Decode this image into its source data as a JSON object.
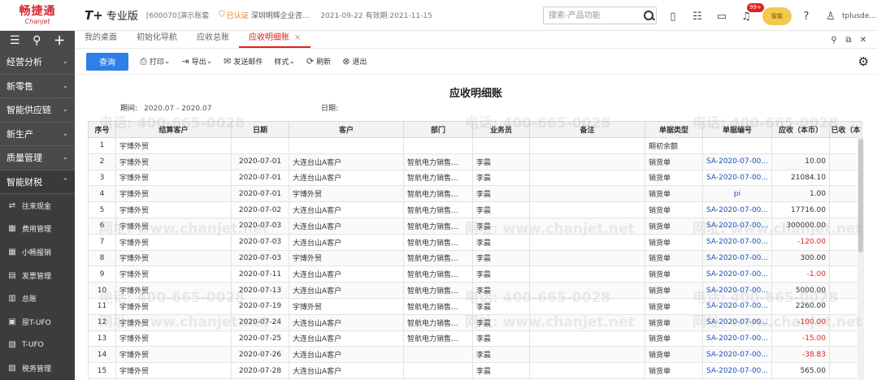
{
  "brand": {
    "name_cn": "畅捷通",
    "name_en": "Chanjet"
  },
  "product": {
    "mark": "T+",
    "edition": "专业版"
  },
  "account": "[600070]演示账套",
  "cert": {
    "label": "已认证",
    "company": "深圳明辉企业咨..."
  },
  "date_info": "2021-09-22  有效期:2021-11-15",
  "search": {
    "placeholder": "搜索-产品功能"
  },
  "header_icons": [
    "phone-icon",
    "checklist-icon",
    "monitor-icon",
    "bell-icon",
    "help-icon",
    "user-icon"
  ],
  "notification_badge": "99+",
  "mascot_text": "智能",
  "user": "tplusde...",
  "sidebar": {
    "groups": [
      {
        "label": "经营分析"
      },
      {
        "label": "新零售"
      },
      {
        "label": "智能供应链"
      },
      {
        "label": "新生产"
      },
      {
        "label": "质量管理"
      },
      {
        "label": "智能财税"
      }
    ],
    "sub_items": [
      {
        "label": "往来现金",
        "icon": "cash-icon"
      },
      {
        "label": "费用管理",
        "icon": "expense-icon"
      },
      {
        "label": "小畅报销",
        "icon": "reimburse-icon"
      },
      {
        "label": "发票管理",
        "icon": "invoice-icon"
      },
      {
        "label": "总账",
        "icon": "ledger-icon"
      },
      {
        "label": "原T-UFO",
        "icon": "ufo-icon"
      },
      {
        "label": "T-UFO",
        "icon": "tufo-icon"
      },
      {
        "label": "税务管理",
        "icon": "tax-icon"
      }
    ]
  },
  "tabs": [
    {
      "label": "我的桌面"
    },
    {
      "label": "初始化导航"
    },
    {
      "label": "应收总账"
    },
    {
      "label": "应收明细账",
      "active": true,
      "close": "×"
    }
  ],
  "toolbar": {
    "query": "查询",
    "print": "打印",
    "export": "导出",
    "send_mail": "发送邮件",
    "style": "样式",
    "refresh": "刷新",
    "exit": "退出"
  },
  "report": {
    "title": "应收明细账",
    "period_label": "期间:",
    "period_value": "2020.07 - 2020.07",
    "date_label": "日期:"
  },
  "table": {
    "columns": [
      "序号",
      "结算客户",
      "日期",
      "客户",
      "部门",
      "业务员",
      "备注",
      "单据类型",
      "单据编号",
      "应收（本币）",
      "已收（本"
    ],
    "rows": [
      [
        "1",
        "宇博外贸",
        "",
        "",
        "",
        "",
        "",
        "期初余额",
        "",
        "",
        ""
      ],
      [
        "2",
        "宇博外贸",
        "2020-07-01",
        "大连台山A客户",
        "智航电力销售...",
        "李晨",
        "",
        "销货单",
        "SA-2020-07-00...",
        "10.00",
        ""
      ],
      [
        "3",
        "宇博外贸",
        "2020-07-01",
        "大连台山A客户",
        "智航电力销售...",
        "李晨",
        "",
        "销货单",
        "SA-2020-07-00...",
        "21084.10",
        ""
      ],
      [
        "4",
        "宇博外贸",
        "2020-07-01",
        "宇博外贸",
        "智航电力销售...",
        "李晨",
        "",
        "销货单",
        "pi",
        "1.00",
        ""
      ],
      [
        "5",
        "宇博外贸",
        "2020-07-02",
        "大连台山A客户",
        "智航电力销售...",
        "李晨",
        "",
        "销货单",
        "SA-2020-07-00...",
        "17716.00",
        ""
      ],
      [
        "6",
        "宇博外贸",
        "2020-07-03",
        "大连台山A客户",
        "智航电力销售...",
        "李晨",
        "",
        "销货单",
        "SA-2020-07-00...",
        "300000.00",
        ""
      ],
      [
        "7",
        "宇博外贸",
        "2020-07-03",
        "大连台山A客户",
        "智航电力销售...",
        "李晨",
        "",
        "销货单",
        "SA-2020-07-00...",
        "-120.00",
        ""
      ],
      [
        "8",
        "宇博外贸",
        "2020-07-03",
        "宇博外贸",
        "智航电力销售...",
        "李晨",
        "",
        "销货单",
        "SA-2020-07-00...",
        "300.00",
        ""
      ],
      [
        "9",
        "宇博外贸",
        "2020-07-11",
        "大连台山A客户",
        "智航电力销售...",
        "李晨",
        "",
        "销货单",
        "SA-2020-07-00...",
        "-1.00",
        ""
      ],
      [
        "10",
        "宇博外贸",
        "2020-07-13",
        "大连台山A客户",
        "智航电力销售...",
        "李晨",
        "",
        "销货单",
        "SA-2020-07-00...",
        "5000.00",
        ""
      ],
      [
        "11",
        "宇博外贸",
        "2020-07-19",
        "宇博外贸",
        "智航电力销售...",
        "李晨",
        "",
        "销货单",
        "SA-2020-07-00...",
        "2260.00",
        ""
      ],
      [
        "12",
        "宇博外贸",
        "2020-07-24",
        "大连台山A客户",
        "智航电力销售...",
        "李晨",
        "",
        "销货单",
        "SA-2020-07-00...",
        "-100.00",
        ""
      ],
      [
        "13",
        "宇博外贸",
        "2020-07-25",
        "大连台山A客户",
        "智航电力销售...",
        "李晨",
        "",
        "销货单",
        "SA-2020-07-00...",
        "-15.00",
        ""
      ],
      [
        "14",
        "宇博外贸",
        "2020-07-26",
        "大连台山A客户",
        "",
        "李晨",
        "",
        "销货单",
        "SA-2020-07-00...",
        "-38.83",
        ""
      ],
      [
        "15",
        "宇博外贸",
        "2020-07-28",
        "大连台山A客户",
        "",
        "李晨",
        "",
        "销货单",
        "SA-2020-07-00...",
        "565.00",
        ""
      ]
    ]
  },
  "watermark": {
    "phone": "电话: 400-665-0028",
    "site": "网址: www.chanjet.net"
  },
  "colors": {
    "brand_red": "#d7262f",
    "accent_blue": "#2f7fe6",
    "sidebar_bg": "#4a4a4a",
    "negative_red": "#e02020",
    "link_blue": "#1f4fb5"
  }
}
